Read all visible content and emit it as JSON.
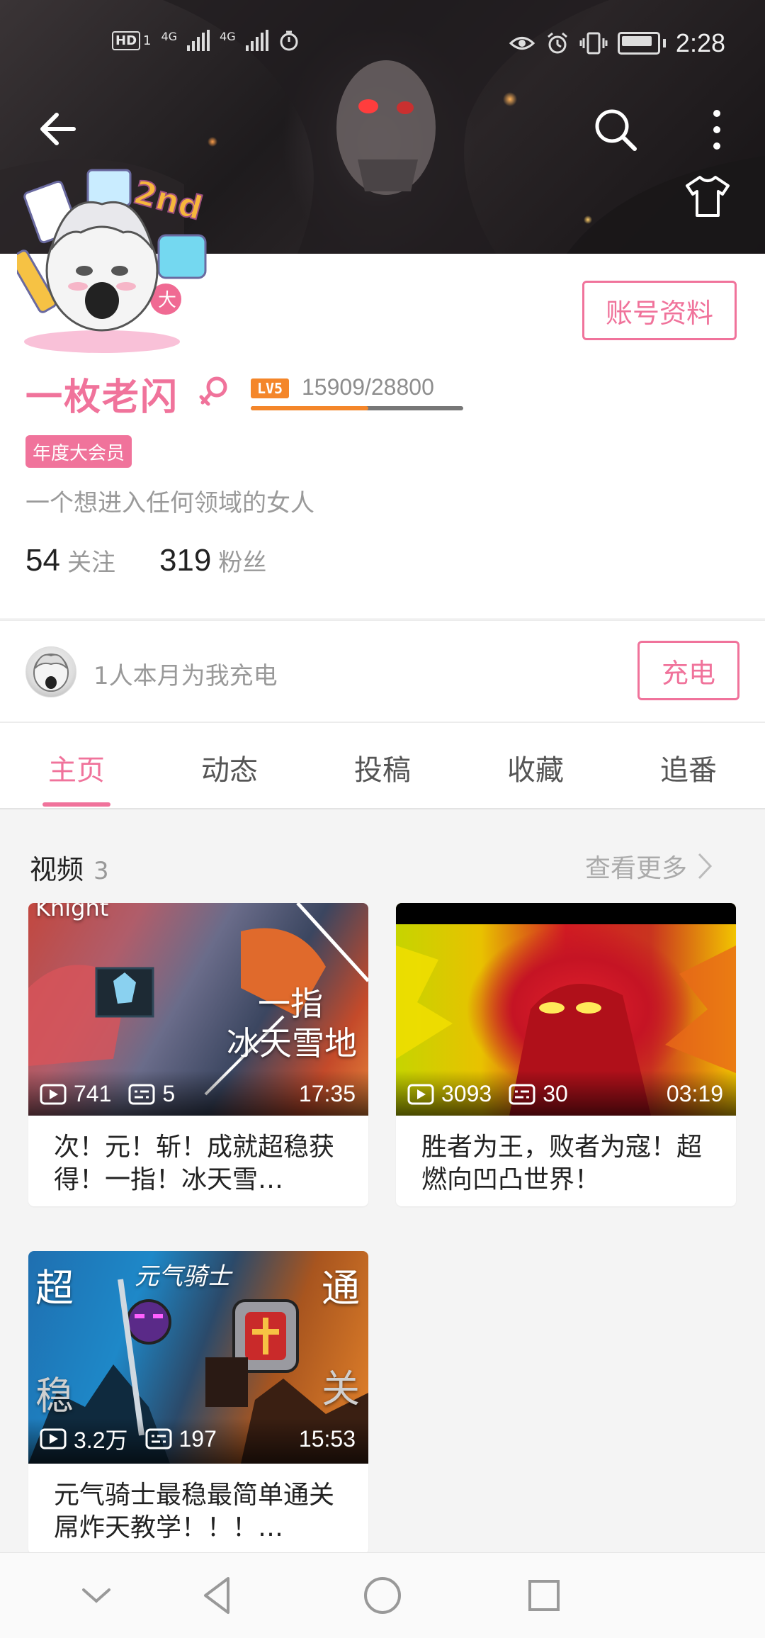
{
  "status_bar": {
    "hd_label": "HD",
    "sim_label": "1",
    "net1": "4G",
    "net2": "4G",
    "time": "2:28"
  },
  "header": {
    "icons": [
      "back-arrow-icon",
      "search-icon",
      "more-vertical-icon",
      "tshirt-skin-icon"
    ]
  },
  "profile": {
    "account_button": "账号资料",
    "name": "一枚老闪",
    "gender": "female",
    "level_badge": "LV5",
    "level_exp": "15909/28800",
    "level_progress": 0.552,
    "vip_badge": "年度大会员",
    "bio": "一个想进入任何领域的女人",
    "following_count": "54",
    "following_label": "关注",
    "fans_count": "319",
    "fans_label": "粉丝"
  },
  "charge": {
    "text": "1人本月为我充电",
    "button": "充电"
  },
  "tabs": [
    {
      "label": "主页",
      "active": true
    },
    {
      "label": "动态",
      "active": false
    },
    {
      "label": "投稿",
      "active": false
    },
    {
      "label": "收藏",
      "active": false
    },
    {
      "label": "追番",
      "active": false
    }
  ],
  "videos_section": {
    "title": "视频",
    "count": "3",
    "see_more": "查看更多"
  },
  "videos": [
    {
      "plays": "741",
      "comments": "5",
      "duration": "17:35",
      "title": "次！元！斩！成就超稳获得！一指！冰天雪…",
      "overlay_line1": "一指",
      "overlay_line2": "冰天雪地",
      "overlay_top": "Knight"
    },
    {
      "plays": "3093",
      "comments": "30",
      "duration": "03:19",
      "title": "胜者为王，败者为寇！超燃向凹凸世界！"
    },
    {
      "plays": "3.2万",
      "comments": "197",
      "duration": "15:53",
      "title": "元气骑士最稳最简单通关屌炸天教学！！！…",
      "overlay_tl": "超",
      "overlay_tr": "通",
      "overlay_bl": "稳",
      "overlay_br": "关",
      "overlay_logo": "元气骑士"
    }
  ],
  "colors": {
    "accent_pink": "#f0739b",
    "level_orange": "#f4862a"
  },
  "navbar": {
    "icons": [
      "collapse-chevron-icon",
      "back-triangle-icon",
      "home-circle-icon",
      "recents-square-icon"
    ]
  }
}
